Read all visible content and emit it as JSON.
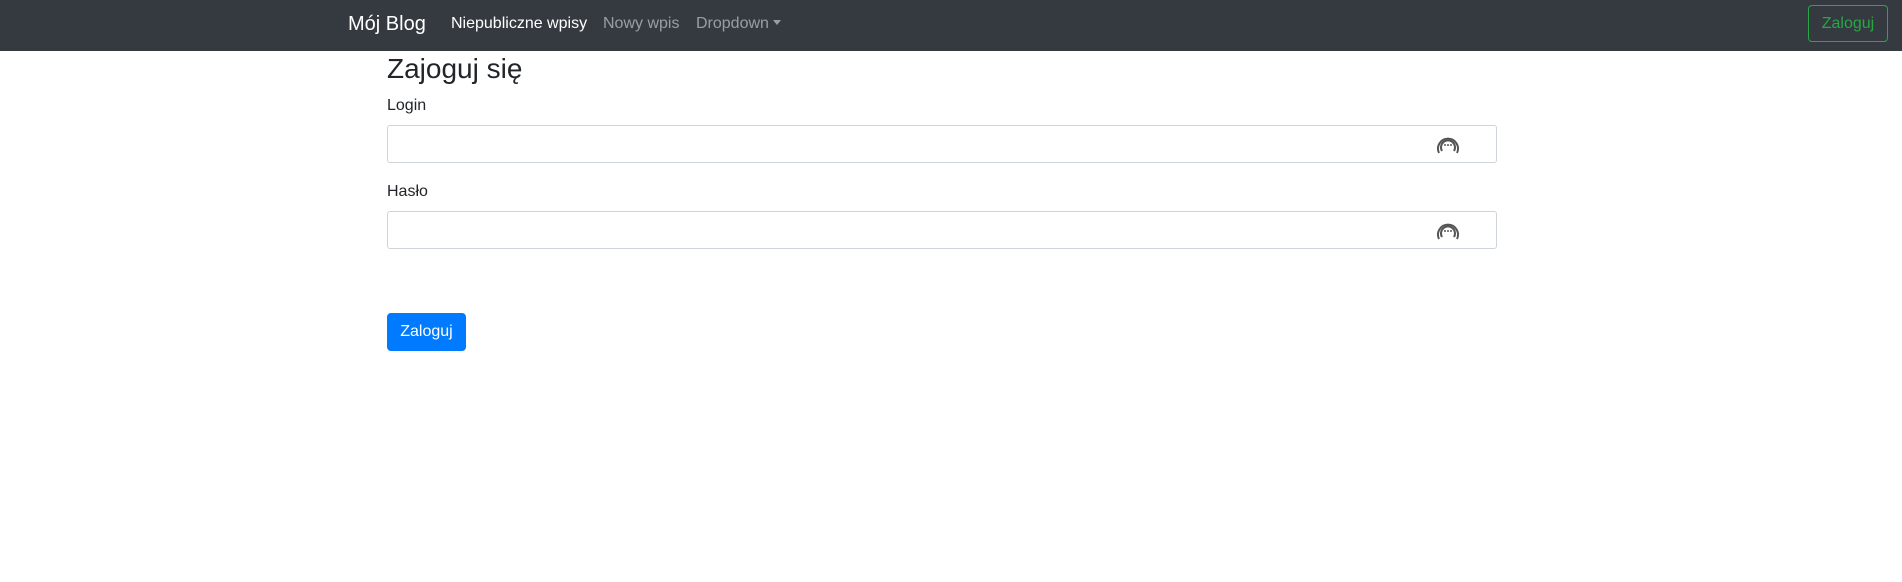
{
  "navbar": {
    "brand": "Mój Blog",
    "links": [
      {
        "label": "Niepubliczne wpisy",
        "active": true
      },
      {
        "label": "Nowy wpis",
        "active": false
      },
      {
        "label": "Dropdown",
        "active": false
      }
    ],
    "login_button": "Zaloguj"
  },
  "form": {
    "title": "Zajoguj się",
    "login_label": "Login",
    "login_value": "",
    "password_label": "Hasło",
    "password_value": "",
    "field_icon": "password-manager-key-icon",
    "submit_label": "Zaloguj"
  },
  "colors": {
    "navbar_bg": "#343a40",
    "success": "#28a745",
    "primary": "#007bff"
  }
}
